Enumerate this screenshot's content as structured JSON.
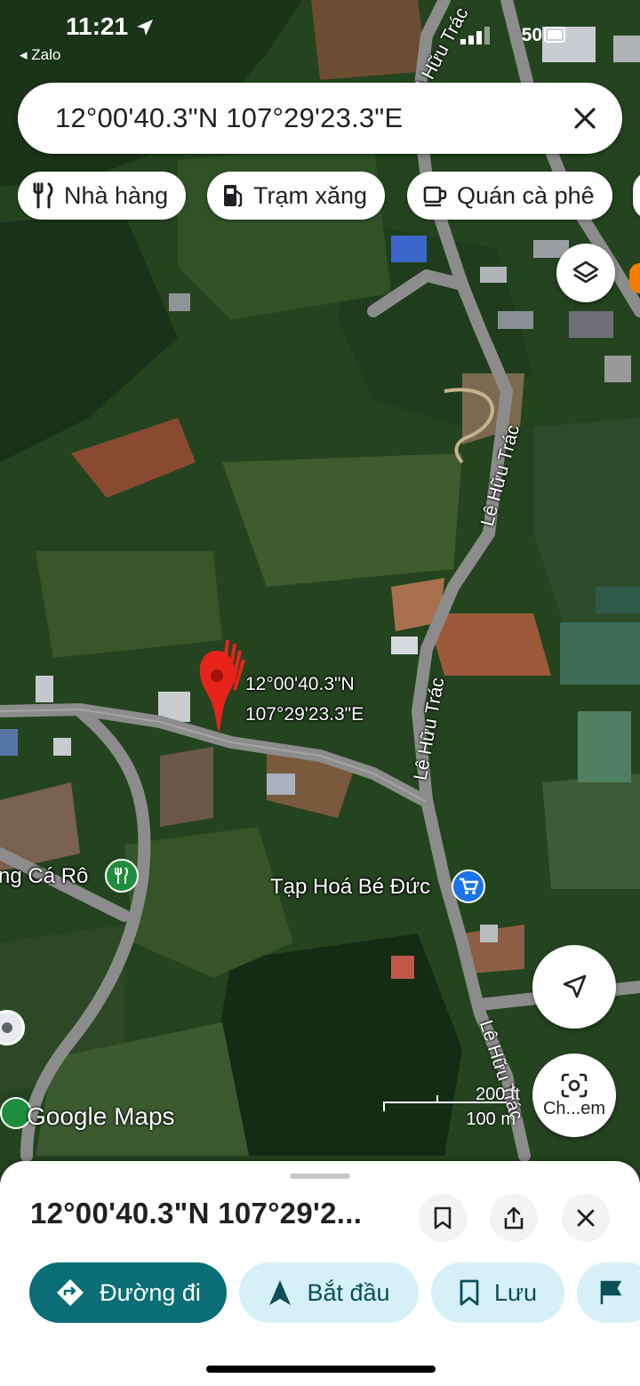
{
  "status_bar": {
    "time": "11:21",
    "back_app": "◂ Zalo",
    "battery": "50"
  },
  "search": {
    "value": "12°00'40.3\"N 107°29'23.3\"E",
    "clear_icon": "close-icon"
  },
  "chips": [
    {
      "label": "Nhà hàng",
      "icon": "restaurant-icon"
    },
    {
      "label": "Trạm xăng",
      "icon": "gas-station-icon"
    },
    {
      "label": "Quán cà phê",
      "icon": "coffee-icon"
    }
  ],
  "map": {
    "pin_label_line1": "12°00'40.3\"N",
    "pin_label_line2": "107°29'23.3\"E",
    "roads": [
      "Lê Hữu Trác",
      "Lê Hữu Trác",
      "Lê Hữu Trác",
      "Lê Hữu Trác"
    ],
    "places": [
      {
        "name": "Tạp Hoá Bé Đức",
        "icon": "shopping-cart-icon"
      },
      {
        "name": "ng Cá Rô",
        "icon": "restaurant-icon"
      }
    ],
    "attribution": "Google Maps",
    "scale_ft": "200 ft",
    "scale_m": "100 m",
    "camera_label": "Ch...em"
  },
  "sheet": {
    "title": "12°00'40.3\"N 107°29'2...",
    "actions": [
      {
        "label": "Đường đi",
        "icon": "directions-icon"
      },
      {
        "label": "Bắt đầu",
        "icon": "navigation-icon"
      },
      {
        "label": "Lưu",
        "icon": "bookmark-icon"
      }
    ]
  },
  "colors": {
    "accent": "#0b6e76",
    "secondary": "#d6f0f7",
    "pin": "#e8231b"
  }
}
